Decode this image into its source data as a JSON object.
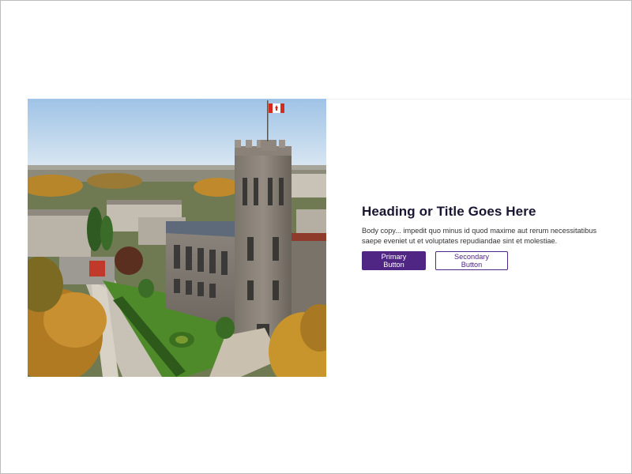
{
  "hero": {
    "image_alt": "Aerial view of a university campus with a stone clock tower flying a Canadian flag",
    "heading": "Heading or Title Goes Here",
    "body": "Body copy... impedit quo minus id quod maxime aut rerum necessitatibus saepe eveniet ut et voluptates repudiandae sint et molestiae.",
    "primary_button_label": "Primary Button",
    "secondary_button_label": "Secondary Button"
  },
  "colors": {
    "brand_purple": "#4f2683",
    "heading_text": "#1a1530",
    "body_text": "#333333",
    "frame_border": "#bdbdbd"
  },
  "icons": {
    "flag": "canadian-flag-icon"
  }
}
